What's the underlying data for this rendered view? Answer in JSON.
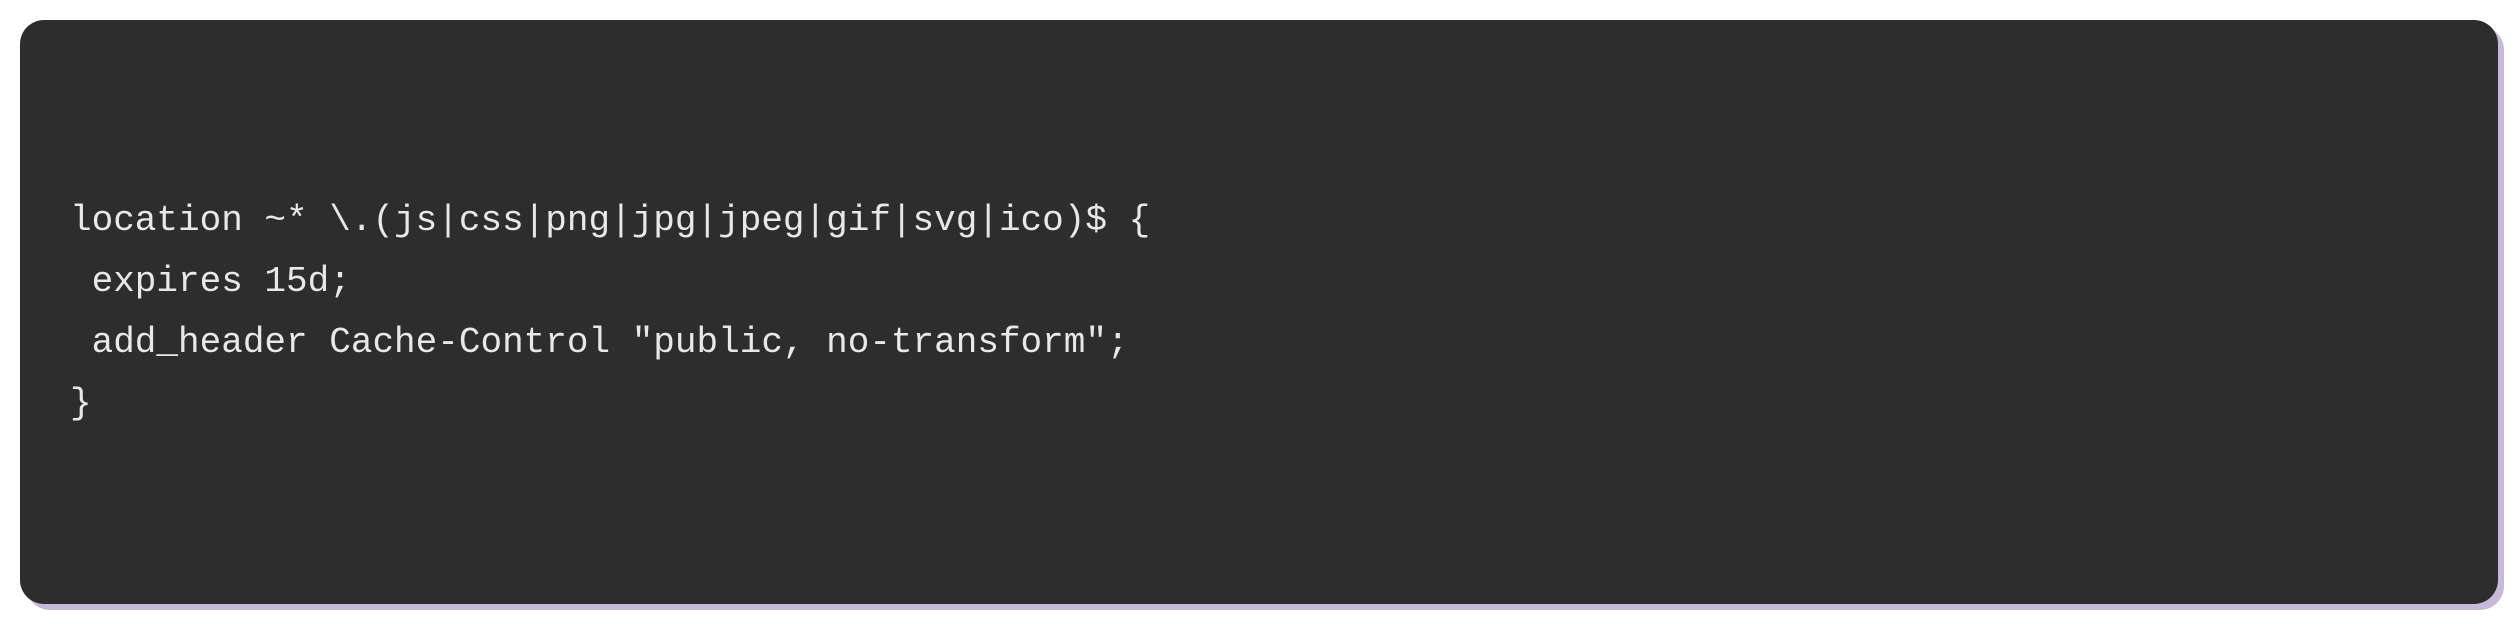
{
  "code": {
    "line1": "location ~* \\.(js|css|png|jpg|jpeg|gif|svg|ico)$ {",
    "line2": " expires 15d;",
    "line3": " add_header Cache-Control \"public, no-transform\";",
    "line4": "}"
  }
}
